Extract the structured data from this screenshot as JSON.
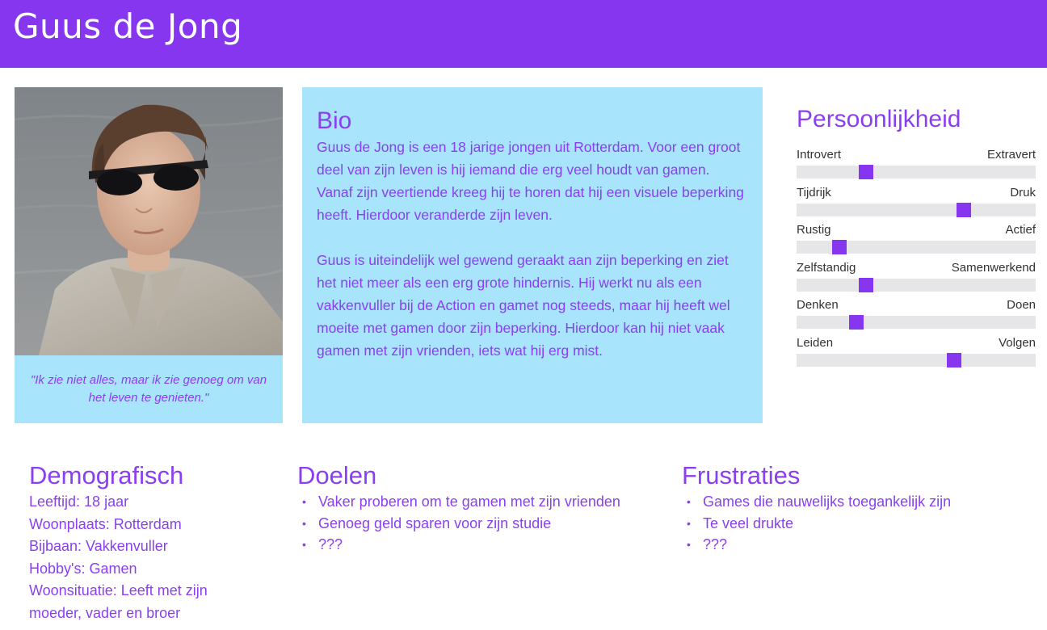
{
  "header": {
    "title": "Guus de Jong"
  },
  "quote": "\"Ik zie niet alles, maar ik zie genoeg om van het leven te genieten.\"",
  "bio": {
    "heading": "Bio",
    "paragraphs": [
      "Guus de Jong is een 18 jarige jongen uit Rotterdam. Voor een groot deel van zijn leven is hij iemand die erg veel houdt van gamen. Vanaf zijn veertiende kreeg hij te horen dat hij een visuele beperking heeft. Hierdoor veranderde zijn leven.",
      "Guus is uiteindelijk wel gewend geraakt aan zijn beperking en ziet het niet meer als een erg grote hindernis. Hij werkt nu als een vakkenvuller bij de Action en gamet nog steeds, maar hij heeft wel moeite met gamen door zijn beperking. Hierdoor kan hij niet vaak gamen met zijn vrienden, iets wat hij erg mist."
    ]
  },
  "personality": {
    "heading": "Persoonlijkheid",
    "accent": "#8636ee",
    "traits": [
      {
        "left": "Introvert",
        "right": "Extravert",
        "value": 0.29
      },
      {
        "left": "Tijdrijk",
        "right": "Druk",
        "value": 0.7
      },
      {
        "left": "Rustig",
        "right": "Actief",
        "value": 0.18
      },
      {
        "left": "Zelfstandig",
        "right": "Samenwerkend",
        "value": 0.29
      },
      {
        "left": "Denken",
        "right": "Doen",
        "value": 0.25
      },
      {
        "left": "Leiden",
        "right": "Volgen",
        "value": 0.66
      }
    ]
  },
  "demographics": {
    "heading": "Demografisch",
    "lines": [
      "Leeftijd: 18 jaar",
      "Woonplaats: Rotterdam",
      "Bijbaan: Vakkenvuller",
      "Hobby's: Gamen",
      "Woonsituatie: Leeft met zijn",
      "moeder, vader en broer"
    ]
  },
  "goals": {
    "heading": "Doelen",
    "items": [
      "Vaker proberen om te gamen met zijn vrienden",
      "Genoeg geld sparen voor zijn studie",
      "???"
    ]
  },
  "frustrations": {
    "heading": "Frustraties",
    "items": [
      "Games die nauwelijks toegankelijk zijn",
      "Te veel drukte",
      "???"
    ]
  },
  "colors": {
    "header": "#8636ee",
    "card": "#a8e4fb",
    "text": "#8a3ff0"
  }
}
